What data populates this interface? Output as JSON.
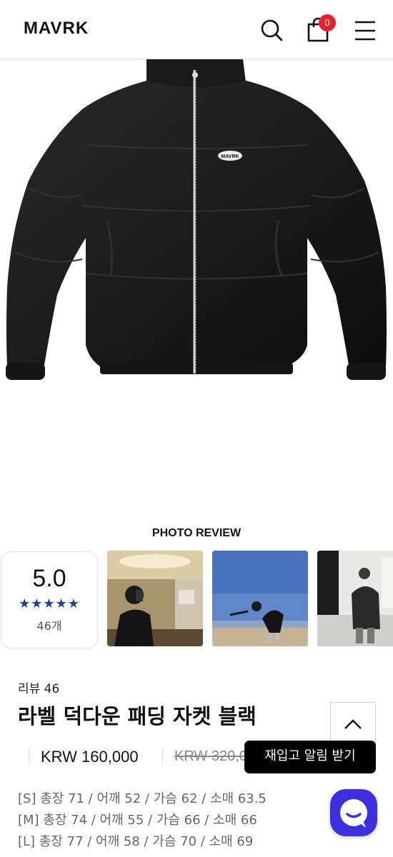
{
  "header": {
    "logo": "MAVRK",
    "cart_count": "0"
  },
  "product_image": {
    "chest_logo": "MAVRK"
  },
  "photo_review": {
    "title": "PHOTO REVIEW",
    "rating": "5.0",
    "stars": "★★★★★",
    "count": "46개"
  },
  "product": {
    "review_label": "리뷰 46",
    "name": "라벨 덕다운 패딩 자켓 블랙",
    "price": "KRW 160,000",
    "original_price": "KRW 320,000"
  },
  "toast": {
    "label": "재입고 알림 받기"
  },
  "sizes": [
    "[S] 총장 71 / 어깨 52 / 가슴 62 / 소매 63.5",
    "[M] 총장 74 / 어깨 55 / 가슴 66 / 소매 66",
    "[L] 총장 77 / 어깨 58 / 가슴 70 / 소매 69"
  ],
  "colors": {
    "badge": "#e8222a",
    "star": "#1d3fa0",
    "chat": "#3b2fe0",
    "toast": "#000000"
  }
}
